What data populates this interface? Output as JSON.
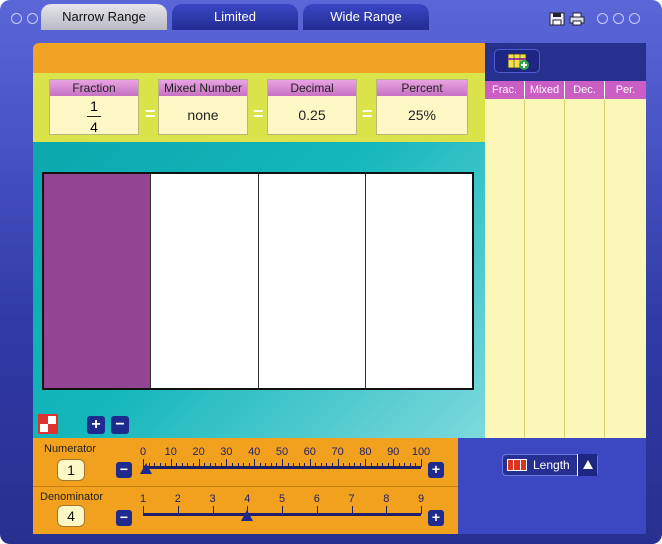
{
  "tabs": [
    {
      "label": "Narrow Range",
      "active": true
    },
    {
      "label": "Limited",
      "active": false
    },
    {
      "label": "Wide Range",
      "active": false
    }
  ],
  "representations": {
    "fraction": {
      "header": "Fraction",
      "numerator": "1",
      "denominator": "4"
    },
    "mixed": {
      "header": "Mixed Number",
      "value": "none"
    },
    "decimal": {
      "header": "Decimal",
      "value": "0.25"
    },
    "percent": {
      "header": "Percent",
      "value": "25%"
    },
    "equals": "="
  },
  "workspace": {
    "segments": 4,
    "shaded": 1,
    "shade_color": "#934594"
  },
  "numerator_slider": {
    "label": "Numerator",
    "value": "1",
    "ticks": [
      "0",
      "10",
      "20",
      "30",
      "40",
      "50",
      "60",
      "70",
      "80",
      "90",
      "100"
    ],
    "position_fraction": 0.01
  },
  "denominator_slider": {
    "label": "Denominator",
    "value": "4",
    "ticks": [
      "1",
      "2",
      "3",
      "4",
      "5",
      "6",
      "7",
      "8",
      "9"
    ],
    "position_fraction": 0.375
  },
  "table": {
    "columns": [
      "Frac.",
      "Mixed",
      "Dec.",
      "Per."
    ]
  },
  "model_selector": {
    "label": "Length"
  },
  "colors": {
    "accent_orange": "#f2a11e",
    "frame_blue": "#2f3aa6",
    "header_pink": "#cb5ec4",
    "card_yellow": "#fdf8c5"
  }
}
